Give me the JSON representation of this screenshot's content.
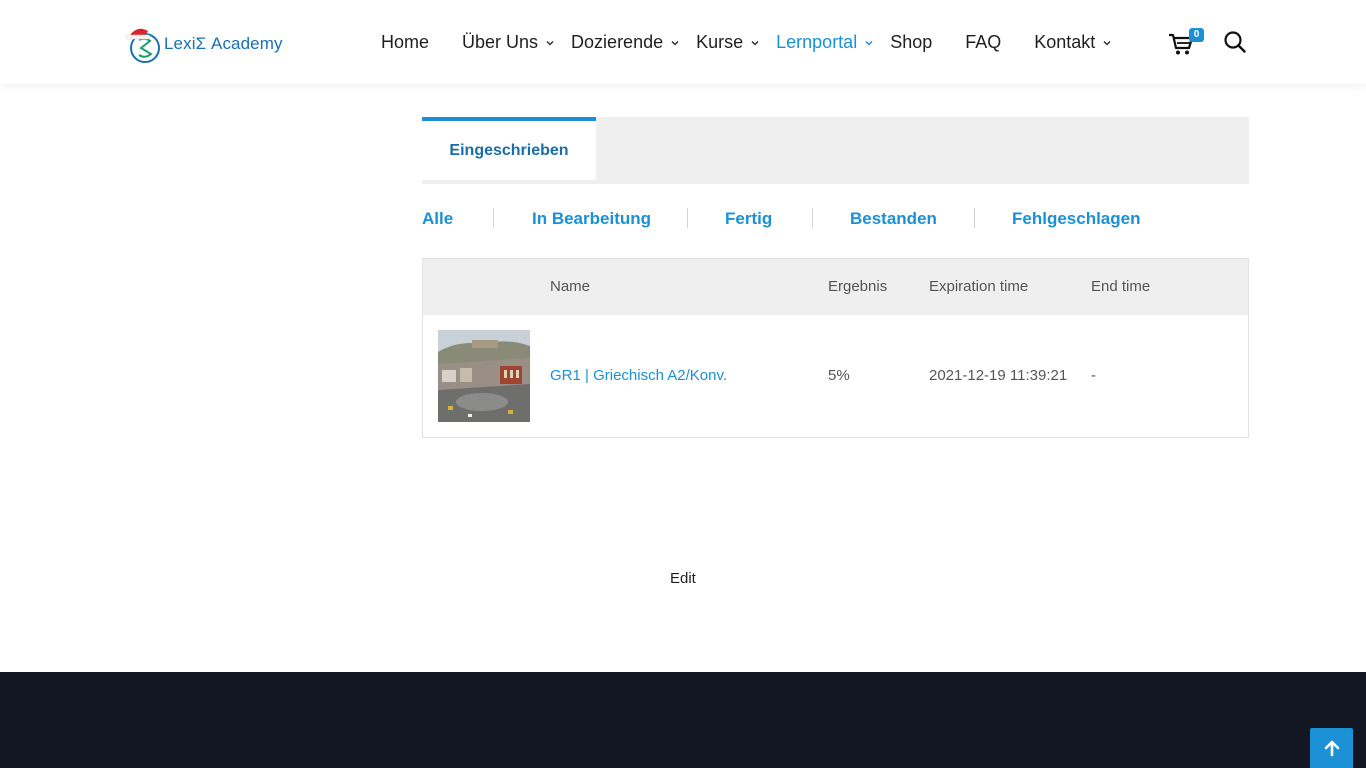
{
  "brand": {
    "name": "LexiΣ Academy",
    "accent": "#1c90d4"
  },
  "nav": {
    "items": [
      {
        "label": "Home",
        "has_dropdown": false,
        "active": false
      },
      {
        "label": "Über Uns",
        "has_dropdown": true,
        "active": false
      },
      {
        "label": "Dozierende",
        "has_dropdown": true,
        "active": false
      },
      {
        "label": "Kurse",
        "has_dropdown": true,
        "active": false
      },
      {
        "label": "Lernportal",
        "has_dropdown": true,
        "active": true
      },
      {
        "label": "Shop",
        "has_dropdown": false,
        "active": false
      },
      {
        "label": "FAQ",
        "has_dropdown": false,
        "active": false
      },
      {
        "label": "Kontakt",
        "has_dropdown": true,
        "active": false
      }
    ],
    "cart_count": "0",
    "icons": [
      "cart-icon",
      "search-icon",
      "chevron-down-icon"
    ]
  },
  "tabs": [
    {
      "label": "Eingeschrieben",
      "active": true
    }
  ],
  "filters": [
    "Alle",
    "In Bearbeitung",
    "Fertig",
    "Bestanden",
    "Fehlgeschlagen"
  ],
  "table": {
    "headers": {
      "name": "Name",
      "result": "Ergebnis",
      "expiration": "Expiration time",
      "end": "End time"
    },
    "rows": [
      {
        "name": "GR1 | Griechisch A2/Konv.",
        "result": "5%",
        "expiration": "2021-12-19 11:39:21",
        "end": "-"
      }
    ]
  },
  "edit_label": "Edit",
  "footer": {
    "background": "#121722"
  }
}
